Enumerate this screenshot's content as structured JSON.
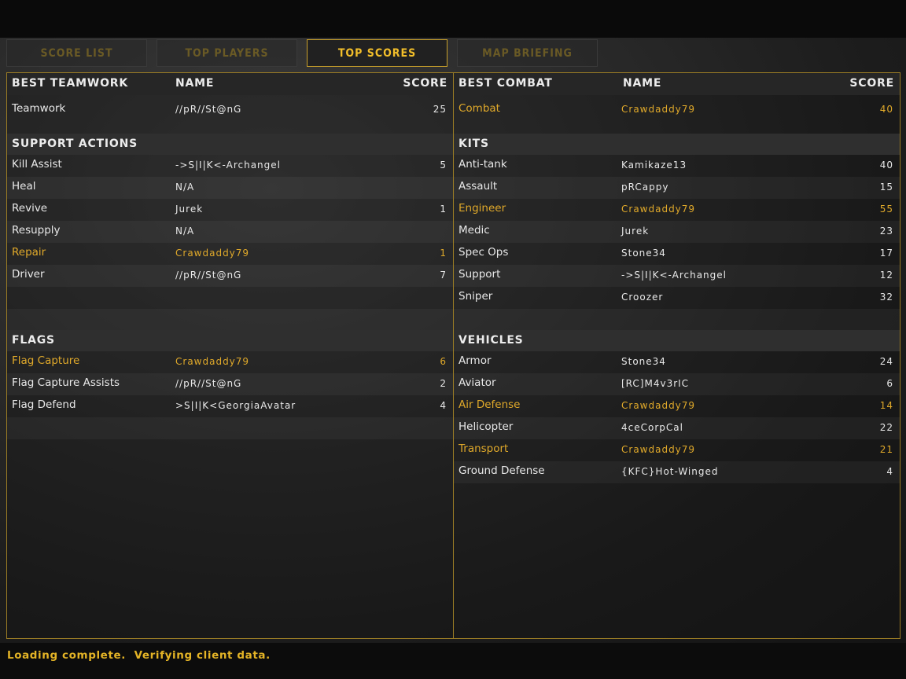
{
  "tabs": [
    {
      "label": "SCORE LIST",
      "active": false
    },
    {
      "label": "TOP PLAYERS",
      "active": false
    },
    {
      "label": "TOP SCORES",
      "active": true
    },
    {
      "label": "MAP BRIEFING",
      "active": false
    }
  ],
  "left": {
    "header": {
      "category": "BEST TEAMWORK",
      "name": "NAME",
      "score": "SCORE"
    },
    "teamwork": [
      {
        "label": "Teamwork",
        "name": "//pR//St@nG",
        "score": "25",
        "highlight": false
      }
    ],
    "support_title": "SUPPORT ACTIONS",
    "support": [
      {
        "label": "Kill Assist",
        "name": "->S|I|K<-Archangel",
        "score": "5",
        "highlight": false
      },
      {
        "label": "Heal",
        "name": "N/A",
        "score": "",
        "highlight": false
      },
      {
        "label": "Revive",
        "name": "Jurek",
        "score": "1",
        "highlight": false
      },
      {
        "label": "Resupply",
        "name": "N/A",
        "score": "",
        "highlight": false
      },
      {
        "label": "Repair",
        "name": "Crawdaddy79",
        "score": "1",
        "highlight": true
      },
      {
        "label": "Driver",
        "name": "//pR//St@nG",
        "score": "7",
        "highlight": false
      }
    ],
    "flags_title": "FLAGS",
    "flags": [
      {
        "label": "Flag Capture",
        "name": "Crawdaddy79",
        "score": "6",
        "highlight": true
      },
      {
        "label": "Flag Capture Assists",
        "name": "//pR//St@nG",
        "score": "2",
        "highlight": false
      },
      {
        "label": "Flag Defend",
        "name": ">S|I|K<GeorgiaAvatar",
        "score": "4",
        "highlight": false
      }
    ]
  },
  "right": {
    "header": {
      "category": "BEST COMBAT",
      "name": "NAME",
      "score": "SCORE"
    },
    "combat": [
      {
        "label": "Combat",
        "name": "Crawdaddy79",
        "score": "40",
        "highlight": true
      }
    ],
    "kits_title": "KITS",
    "kits": [
      {
        "label": "Anti-tank",
        "name": "Kamikaze13",
        "score": "40",
        "highlight": false
      },
      {
        "label": "Assault",
        "name": "pRCappy",
        "score": "15",
        "highlight": false
      },
      {
        "label": "Engineer",
        "name": "Crawdaddy79",
        "score": "55",
        "highlight": true
      },
      {
        "label": "Medic",
        "name": "Jurek",
        "score": "23",
        "highlight": false
      },
      {
        "label": "Spec Ops",
        "name": "Stone34",
        "score": "17",
        "highlight": false
      },
      {
        "label": "Support",
        "name": "->S|I|K<-Archangel",
        "score": "12",
        "highlight": false
      },
      {
        "label": "Sniper",
        "name": "Croozer",
        "score": "32",
        "highlight": false
      }
    ],
    "vehicles_title": "VEHICLES",
    "vehicles": [
      {
        "label": "Armor",
        "name": "Stone34",
        "score": "24",
        "highlight": false
      },
      {
        "label": "Aviator",
        "name": "[RC]M4v3rIC",
        "score": "6",
        "highlight": false
      },
      {
        "label": "Air Defense",
        "name": "Crawdaddy79",
        "score": "14",
        "highlight": true
      },
      {
        "label": "Helicopter",
        "name": "4ceCorpCal",
        "score": "22",
        "highlight": false
      },
      {
        "label": "Transport",
        "name": "Crawdaddy79",
        "score": "21",
        "highlight": true
      },
      {
        "label": "Ground Defense",
        "name": "{KFC}Hot-Winged",
        "score": "4",
        "highlight": false
      }
    ]
  },
  "status": "Loading complete.  Verifying client data.",
  "colors": {
    "accent": "#f2be2a",
    "highlight": "#e0a92a",
    "border": "#9a7c25"
  }
}
